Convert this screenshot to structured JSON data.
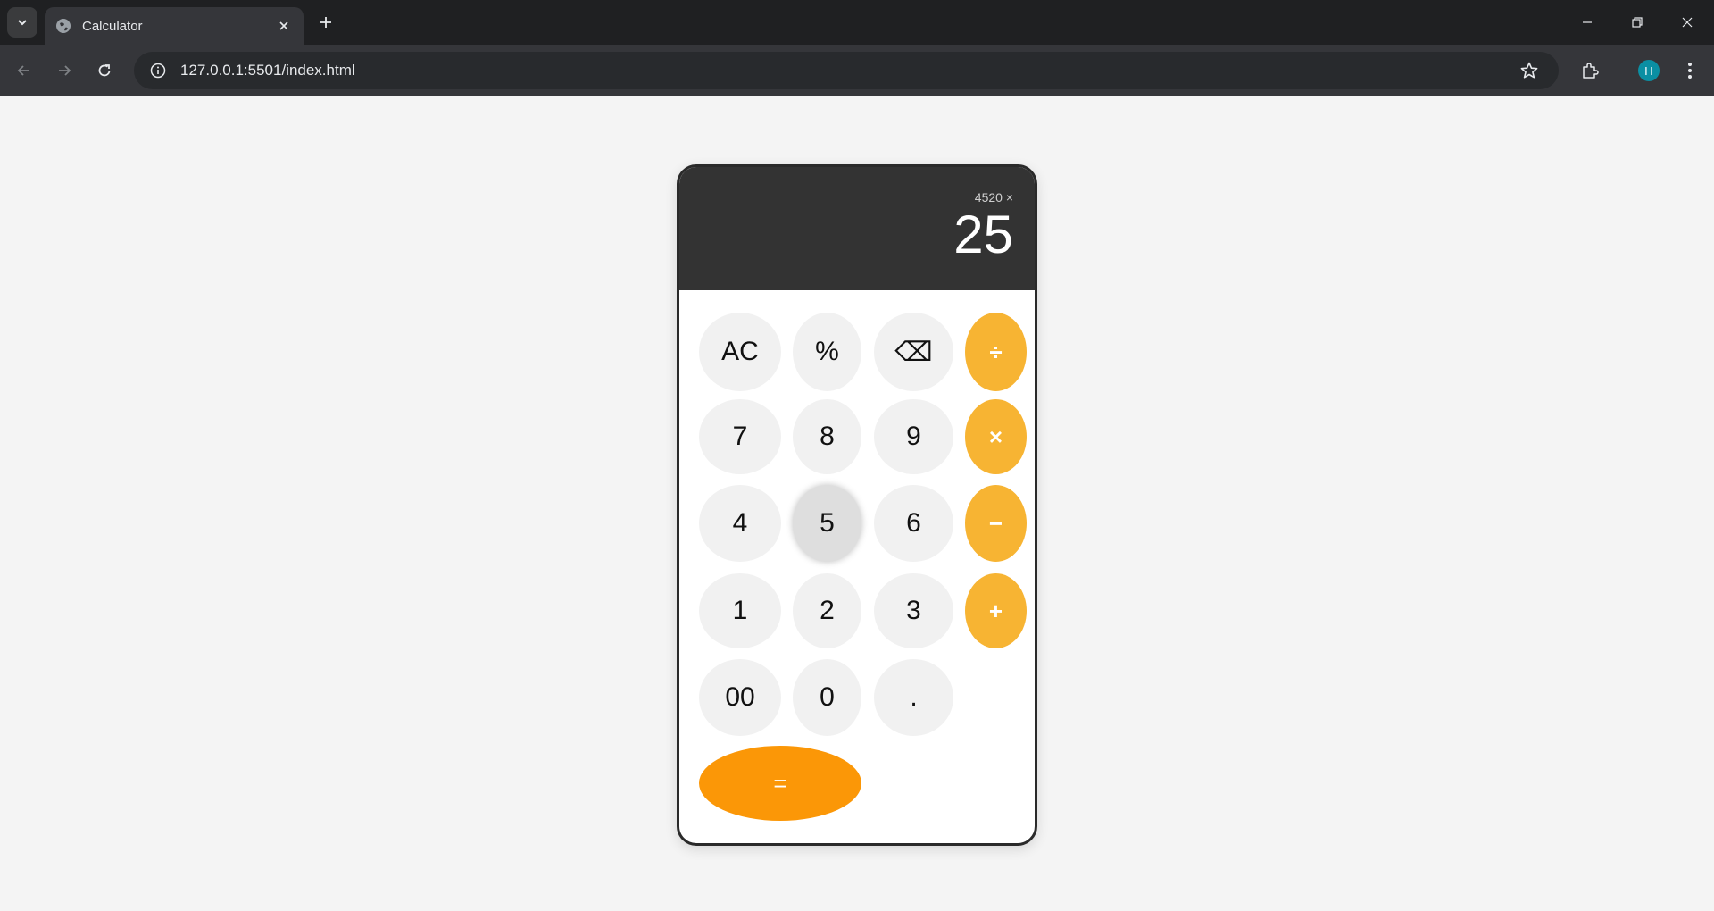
{
  "browser": {
    "tab_title": "Calculator",
    "url": "127.0.0.1:5501/index.html",
    "profile_initial": "H"
  },
  "calculator": {
    "expression": "4520 ×",
    "result": "25",
    "keys": {
      "all_clear": "AC",
      "percent": "%",
      "backspace": "⌫",
      "divide": "÷",
      "seven": "7",
      "eight": "8",
      "nine": "9",
      "multiply": "×",
      "four": "4",
      "five": "5",
      "six": "6",
      "minus": "−",
      "one": "1",
      "two": "2",
      "three": "3",
      "plus": "+",
      "double_zero": "00",
      "zero": "0",
      "decimal": ".",
      "equals": "="
    },
    "colors": {
      "operator": "#f7b433",
      "equals": "#fb9707",
      "display": "#333333",
      "key": "#f1f1f1"
    }
  }
}
